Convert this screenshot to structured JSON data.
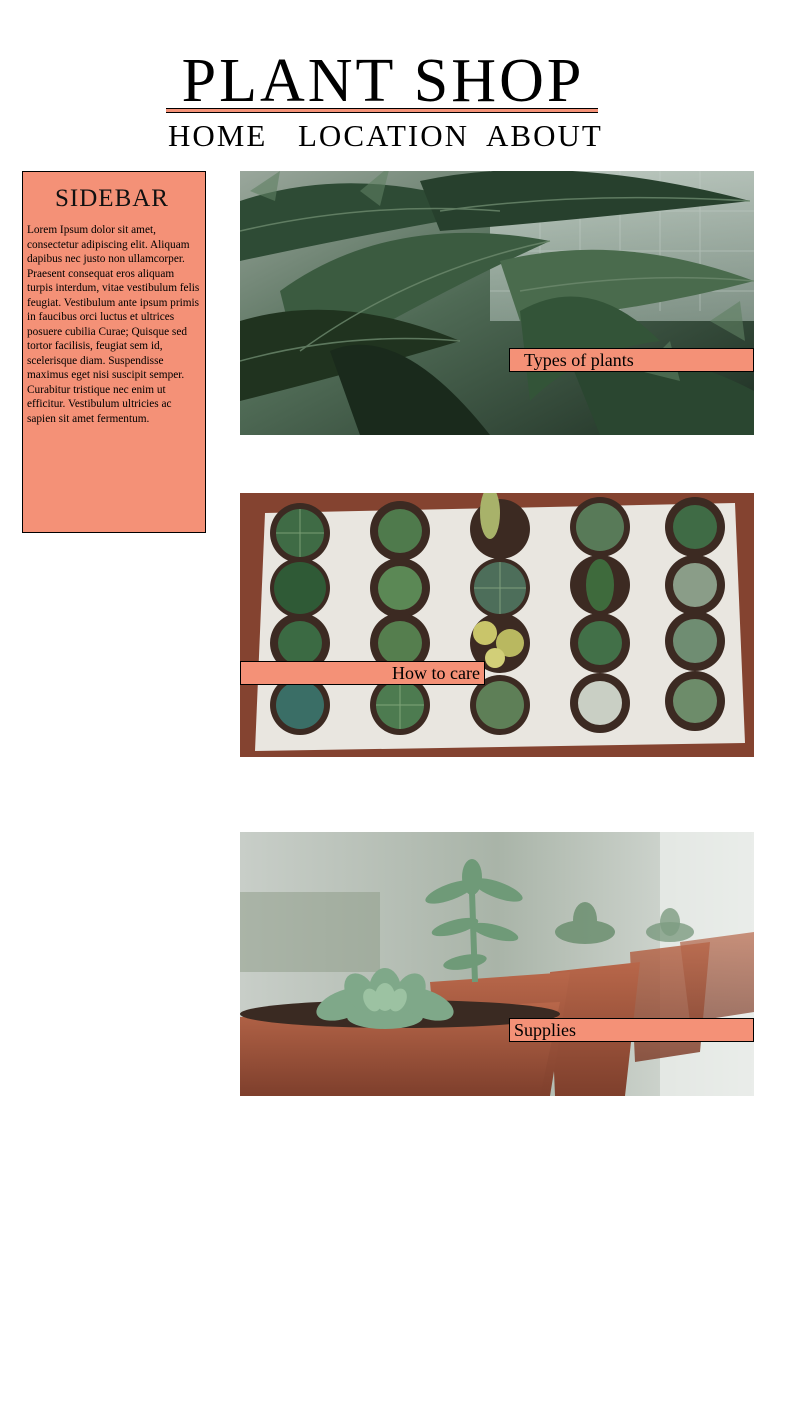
{
  "header": {
    "title": "PLANT SHOP",
    "accent_color": "#f49177"
  },
  "nav": {
    "items": [
      {
        "label": "HOME"
      },
      {
        "label": "LOCATION"
      },
      {
        "label": "ABOUT"
      }
    ]
  },
  "sidebar": {
    "heading": "SIDEBAR",
    "body": "Lorem Ipsum dolor sit amet, consectetur adipiscing elit. Aliquam dapibus nec justo non ullamcorper. Praesent consequat eros aliquam turpis interdum, vitae vestibulum felis feugiat. Vestibulum ante ipsum primis in faucibus orci luctus et ultrices posuere cubilia Curae; Quisque sed tortor facilisis, feugiat sem id, scelerisque diam. Suspendisse maximus eget nisi suscipit semper. Curabitur tristique nec enim ut efficitur. Vestibulum ultricies ac sapien sit amet fermentum.",
    "background_color": "#f49177"
  },
  "cards": [
    {
      "label": "Types of plants",
      "image": "tropical-leaves-photo"
    },
    {
      "label": "How to care",
      "image": "potted-cacti-photo"
    },
    {
      "label": "Supplies",
      "image": "succulents-in-terracotta-pots-photo"
    }
  ]
}
